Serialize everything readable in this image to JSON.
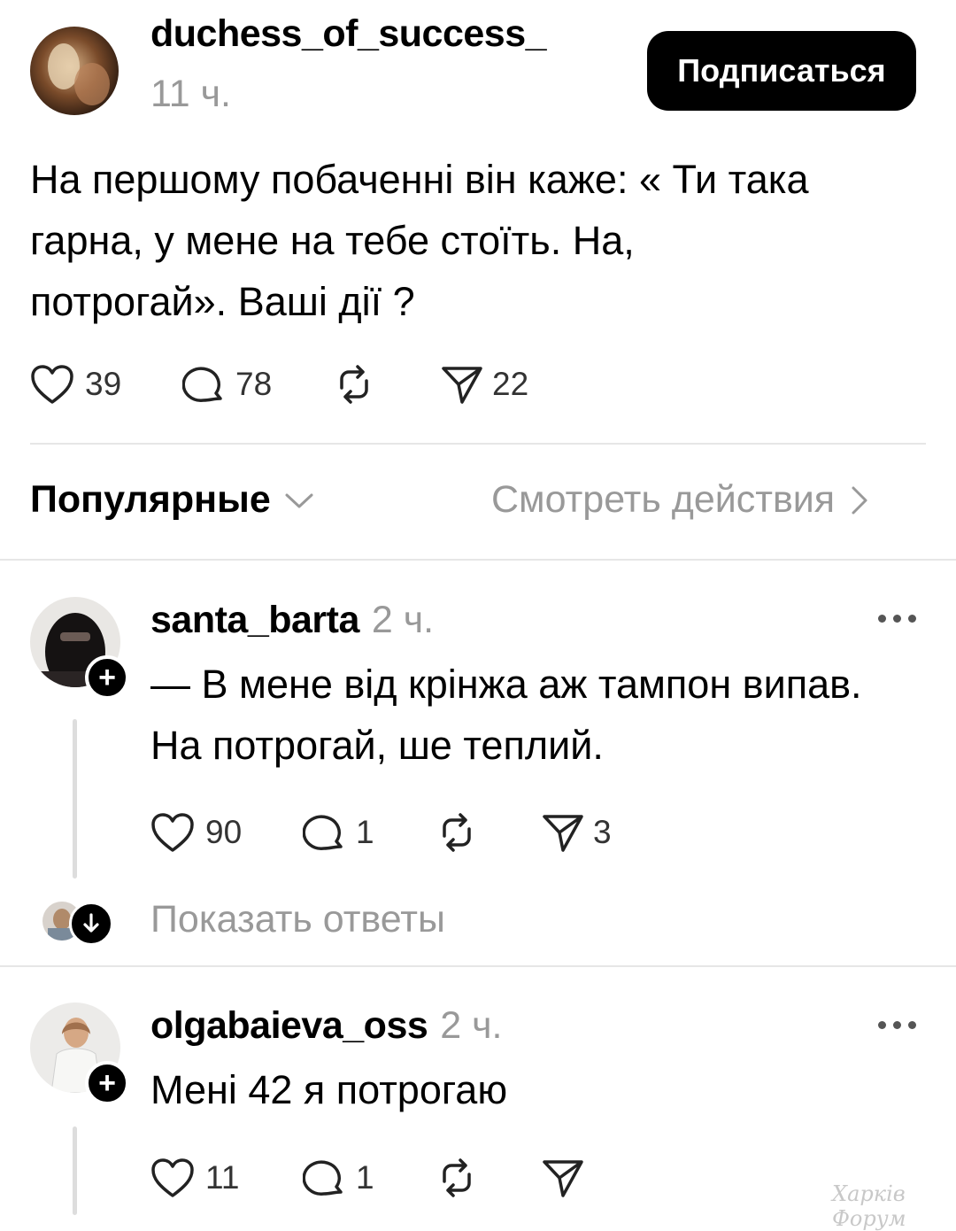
{
  "post": {
    "author": "duchess_of_success_",
    "time": "11 ч.",
    "follow_label": "Подписаться",
    "text_lines": [
      "На першому побаченні він каже: « Ти така",
      "гарна, у мене на тебе стоїть. На,",
      "потрогай». Ваші дії ?"
    ],
    "likes": "39",
    "comments": "78",
    "shares": "22"
  },
  "filter": {
    "sort_label": "Популярные",
    "activity_label": "Смотреть действия"
  },
  "replies": [
    {
      "author": "santa_barta",
      "time": "2 ч.",
      "text_lines": [
        "— В мене від крінжа аж тампон випав.",
        "На потрогай, ше теплий."
      ],
      "likes": "90",
      "comments": "1",
      "shares": "3",
      "show_replies_label": "Показать ответы"
    },
    {
      "author": "olgabaieva_oss",
      "time": "2 ч.",
      "text_lines": [
        "Мені 42 я потрогаю"
      ],
      "likes": "11",
      "comments": "1",
      "shares": ""
    }
  ],
  "icons": {
    "like": "heart-icon",
    "comment": "comment-bubble-icon",
    "repost": "repost-icon",
    "share": "send-icon",
    "more": "more-dots-icon",
    "chevron_down": "chevron-down-icon",
    "chevron_right": "chevron-right-icon",
    "plus": "plus-icon",
    "arrow_down": "arrow-down-icon"
  },
  "colors": {
    "text": "#000000",
    "muted": "#999999",
    "button_bg": "#000000",
    "divider": "#e6e6e6"
  },
  "watermark": "Харків Форум"
}
